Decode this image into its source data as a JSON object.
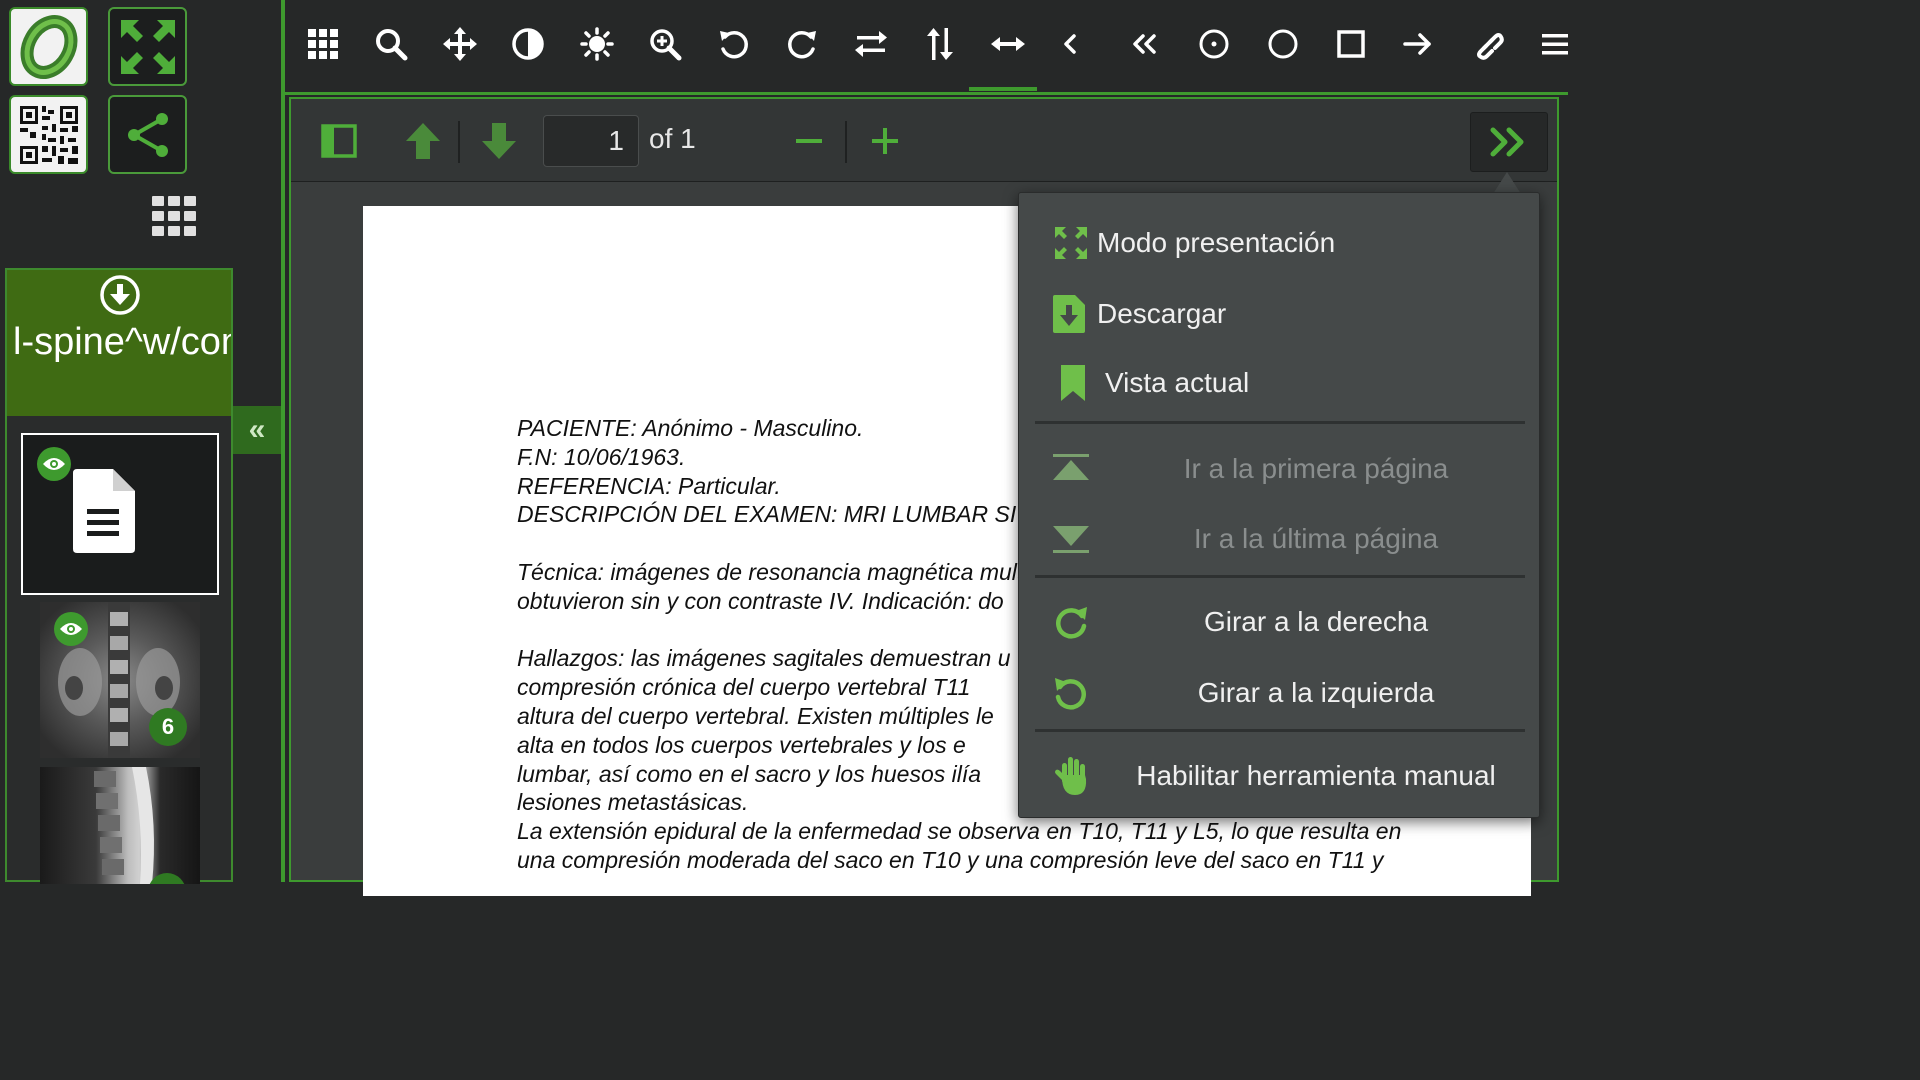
{
  "left_panel": {
    "series_label": "l-spine^w/cont",
    "series_thumbnails": [
      {
        "kind": "document"
      },
      {
        "kind": "mri-coronal",
        "count": "6"
      },
      {
        "kind": "mri-sagittal"
      }
    ]
  },
  "top_toolbar": {
    "tools": [
      "apps-grid",
      "search",
      "pan",
      "contrast",
      "brightness",
      "zoom-in",
      "rotate-left",
      "rotate-right",
      "flip-horizontal",
      "flip-vertical",
      "horizontal-measure",
      "previous",
      "rewind",
      "ellipse-roi",
      "circle-roi",
      "rectangle-roi",
      "arrow",
      "link",
      "menu"
    ],
    "active_tool": "horizontal-measure"
  },
  "pdf_toolbar": {
    "page_number": "1",
    "page_count_label": "of 1"
  },
  "document": {
    "lines_header": [
      "PACIENTE: Anónimo - Masculino.",
      "F.N: 10/06/1963.",
      "REFERENCIA: Particular.",
      "DESCRIPCIÓN DEL EXAMEN: MRI LUMBAR SI"
    ],
    "tecnica": [
      "Técnica: imágenes de resonancia magnética multiplanar",
      "obtuvieron sin y con contraste IV.  Indicación: do"
    ],
    "hallazgos": [
      "Hallazgos: las imágenes sagitales demuestran u",
      "compresión crónica del cuerpo vertebral T11",
      "altura del cuerpo vertebral.  Existen múltiples le",
      "alta en todos los cuerpos vertebrales y los e",
      "lumbar, así como en el sacro y los huesos ilía",
      "lesiones metastásicas."
    ],
    "extension": [
      "La extensión epidural de la enfermedad se observa en T10, T11 y L5, lo que resulta en",
      "una compresión moderada del saco en T10 y una compresión leve del saco en T11 y"
    ]
  },
  "menu": {
    "items": [
      {
        "label": "Modo presentación",
        "icon": "fullscreen-icon",
        "enabled": true
      },
      {
        "label": "Descargar",
        "icon": "download-file-icon",
        "enabled": true
      },
      {
        "label": "Vista actual",
        "icon": "bookmark-icon",
        "enabled": true
      },
      {
        "label": "Ir a la primera página",
        "icon": "first-page-icon",
        "enabled": false
      },
      {
        "label": "Ir a la última página",
        "icon": "last-page-icon",
        "enabled": false
      },
      {
        "label": "Girar a la derecha",
        "icon": "rotate-cw-icon",
        "enabled": true
      },
      {
        "label": "Girar a la izquierda",
        "icon": "rotate-ccw-icon",
        "enabled": true
      },
      {
        "label": "Habilitar herramienta manual",
        "icon": "hand-tool-icon",
        "enabled": true
      }
    ]
  },
  "colors": {
    "accent_green": "#3e9a2e",
    "series_header_green": "#3f6b13",
    "panel_dark": "#262828",
    "menu_bg": "#454949"
  }
}
